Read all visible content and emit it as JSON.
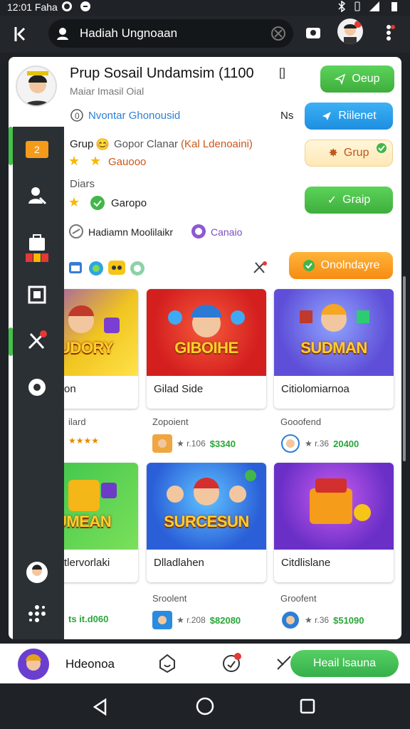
{
  "status": {
    "time": "12:01 Faha"
  },
  "search": {
    "text": "Hadiah Ungnoaan"
  },
  "group": {
    "title": "Prup Sosail Undamsim (1100",
    "subtitle": "Maiar Imasil Oial",
    "bracket": "[]",
    "member_line": "Nvontar Ghonousid",
    "member_badge": "Ns",
    "grup_label": "Grup",
    "grup_detail": "Gopor Clanar",
    "grup_detail_highlight": "(Kal Ldenoaini)",
    "rating_label": "Gauooo",
    "diars_label": "Diars",
    "diars_value": "Garopo",
    "mod_line": "Hadiamn Moolilaikr",
    "mod_tag": "Canaio"
  },
  "buttons": {
    "oeup": "Oeup",
    "riilenet": "Riilenet",
    "grup": "Grup",
    "graip": "Graip",
    "onolndayre": "Onolndayre",
    "heail": "Heail lsauna"
  },
  "cards": [
    {
      "art": "GIUDORY",
      "name": "on",
      "meta": "ilard",
      "rating": "★★★★",
      "price": ""
    },
    {
      "art": "GIBOIHE",
      "name": "Gilad Side",
      "meta": "Zopoient",
      "rating": "★ r.106",
      "price": "$3340"
    },
    {
      "art": "SUDMAN",
      "name": "Citiolomiarnoa",
      "meta": "Gooofend",
      "rating": "★ r.36",
      "price": "20400"
    },
    {
      "art": "SUMEAN",
      "name": "tlervorlaki",
      "meta": "",
      "rating": "",
      "price": ""
    },
    {
      "art": "SURCESUN",
      "name": "Dlladlahen",
      "meta": "Sroolent",
      "rating": "★ r.208",
      "price": "$82080"
    },
    {
      "art": "",
      "name": "Citdlislane",
      "meta": "Groofent",
      "rating": "★ r.36",
      "price": "$51090"
    }
  ],
  "card_prices_left": {
    "row2": "ts it.d060"
  },
  "bottom": {
    "label": "Hdeonoa"
  },
  "colors": {
    "accent_green": "#45c148",
    "accent_blue": "#1d8fe0",
    "accent_orange": "#f68b12"
  }
}
